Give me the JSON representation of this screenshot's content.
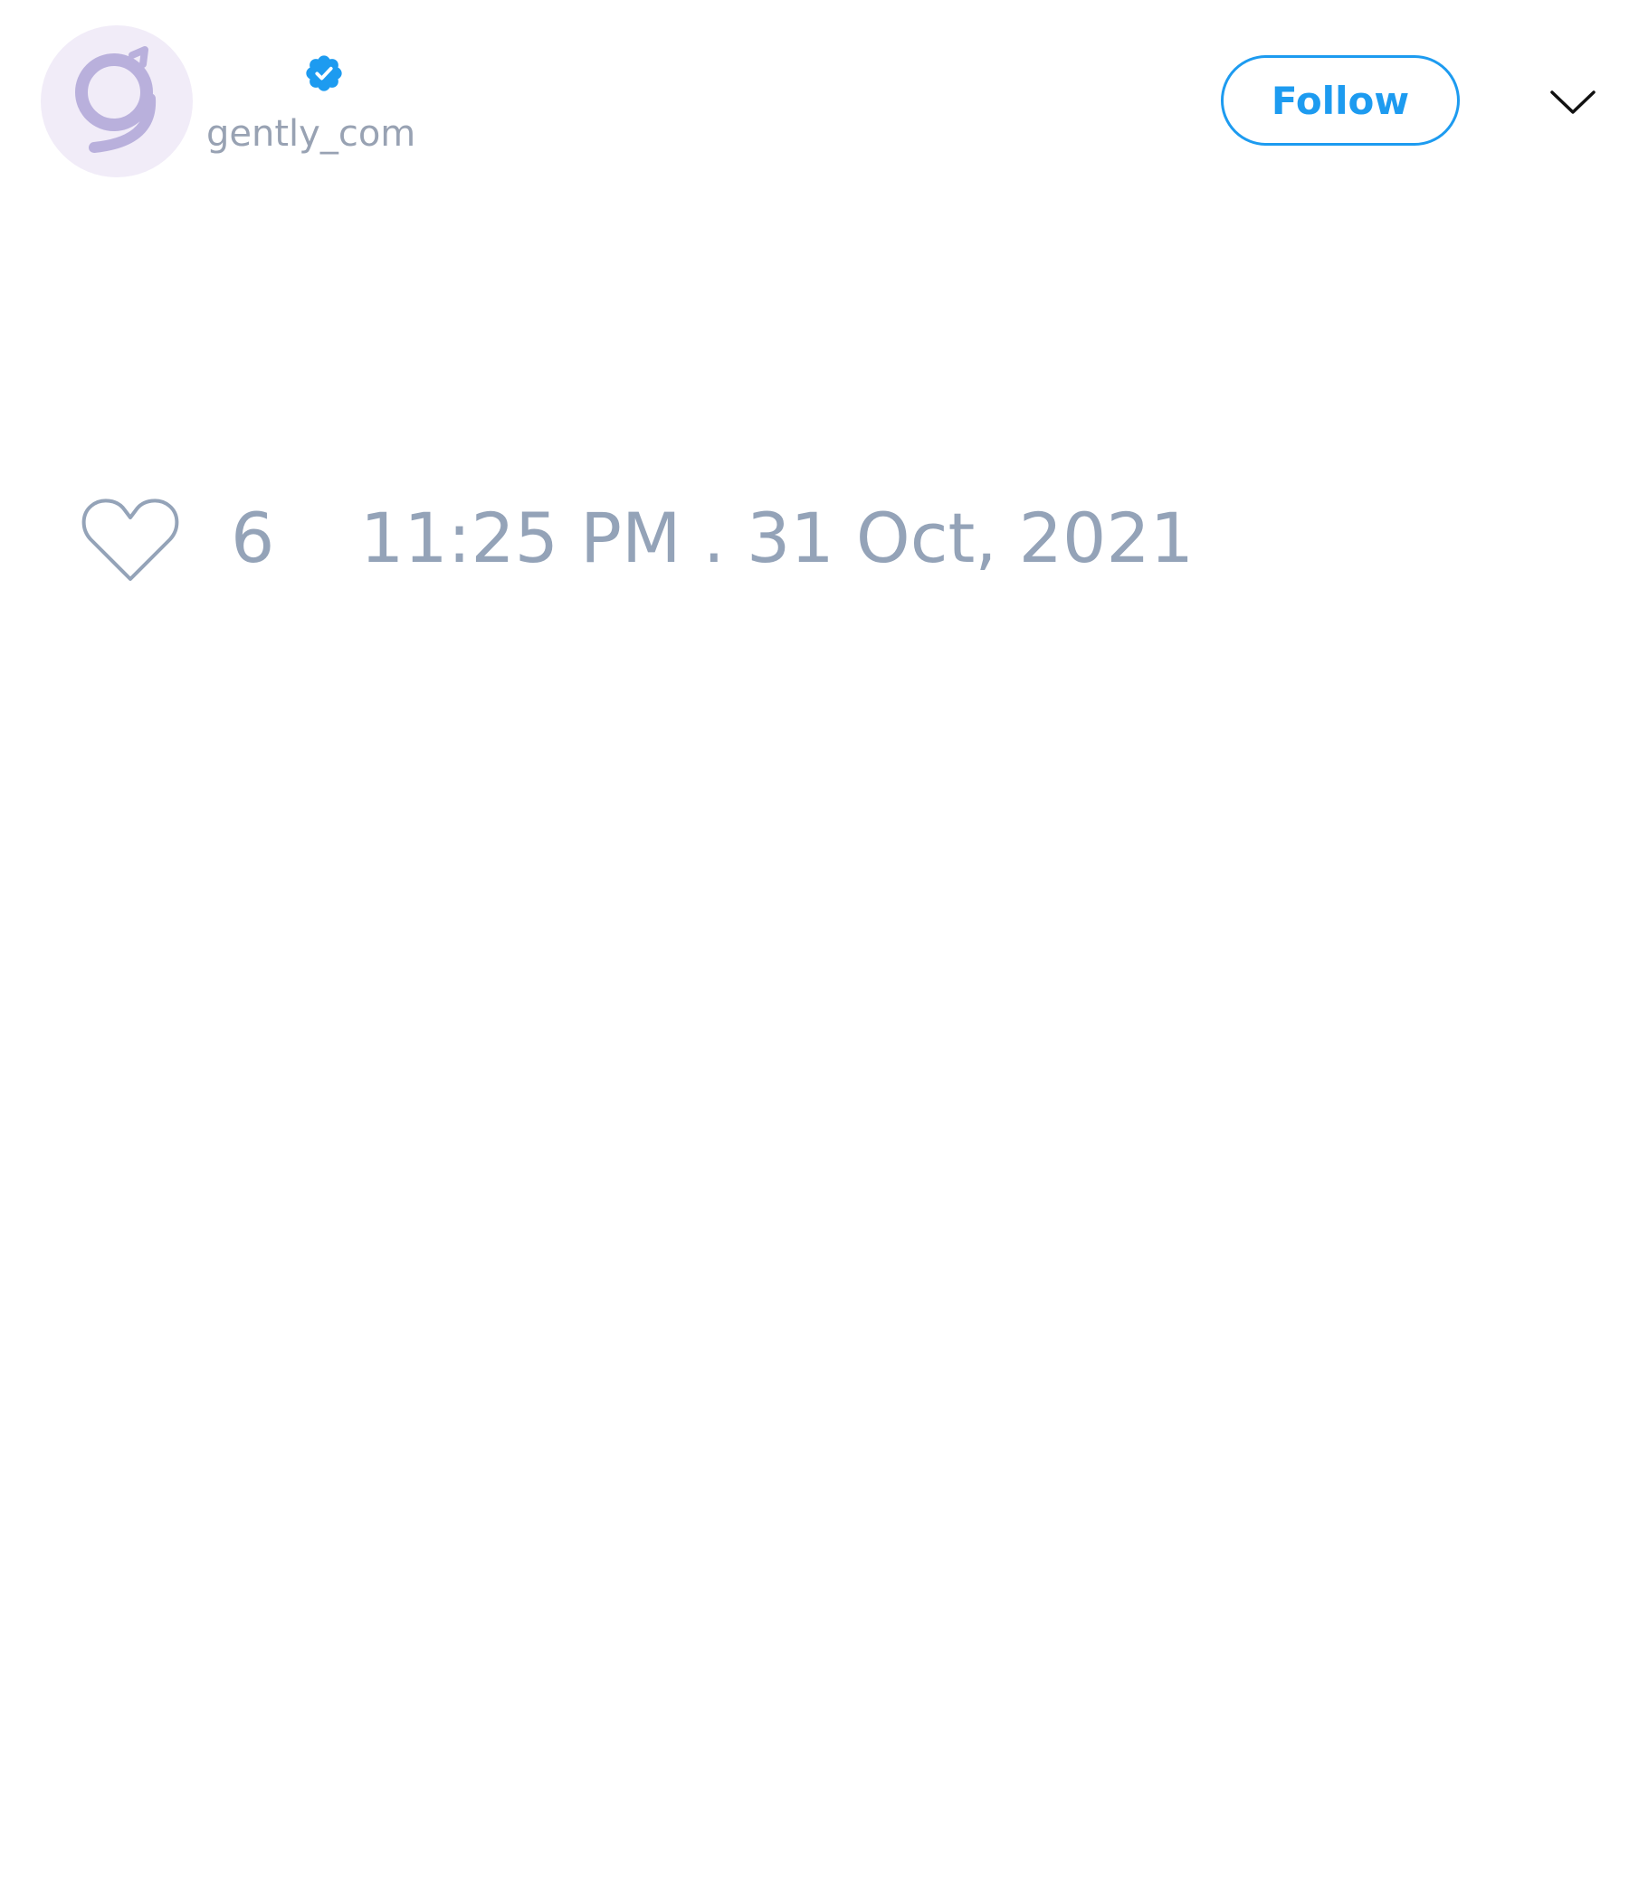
{
  "user": {
    "handle": "gently_com",
    "verified": true,
    "avatar_icon": "gently-logo-icon"
  },
  "header": {
    "follow_label": "Follow",
    "menu_icon": "chevron-down-icon"
  },
  "tweet": {
    "like_icon": "heart-outline-icon",
    "like_count": "6",
    "timestamp": "11:25 PM . 31 Oct, 2021"
  },
  "colors": {
    "accent": "#1d9bf0",
    "muted_text": "#94a3b8",
    "avatar_bg": "#f1ecf8",
    "logo": "#b9b0dc"
  }
}
